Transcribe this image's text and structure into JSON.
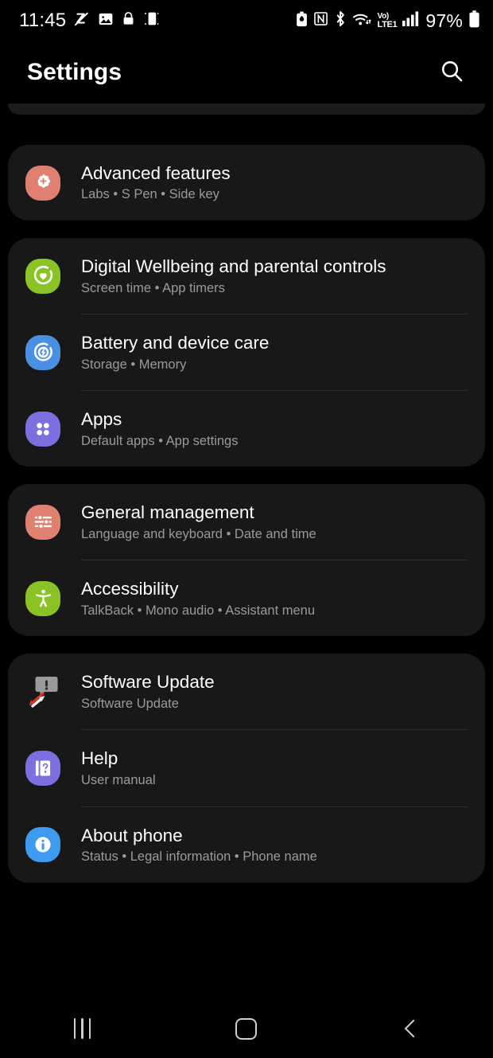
{
  "status_bar": {
    "time": "11:45",
    "battery_percent": "97%",
    "network_label": "LTE1",
    "volte_label": "Vo)",
    "left_icons": [
      "do-not-disturb-icon",
      "gallery-image-icon",
      "lock-icon",
      "screen-mirror-icon"
    ],
    "right_icons": [
      "battery-saver-icon",
      "nfc-icon",
      "bluetooth-icon",
      "wifi-icon",
      "volte-icon",
      "signal-bars-icon",
      "battery-icon"
    ]
  },
  "header": {
    "title": "Settings",
    "search_icon": "search-icon"
  },
  "sections": [
    {
      "id": "section-advanced",
      "items": [
        {
          "id": "advanced-features",
          "title": "Advanced features",
          "subtitle": "Labs  •  S Pen  •  Side key",
          "icon": "advanced-features-icon",
          "icon_bg": "#e08070"
        }
      ]
    },
    {
      "id": "section-wellbeing",
      "items": [
        {
          "id": "digital-wellbeing",
          "title": "Digital Wellbeing and parental controls",
          "subtitle": "Screen time  •  App timers",
          "icon": "digital-wellbeing-icon",
          "icon_bg": "#8bc225"
        },
        {
          "id": "battery-device-care",
          "title": "Battery and device care",
          "subtitle": "Storage  •  Memory",
          "icon": "battery-device-care-icon",
          "icon_bg": "#4a90e2"
        },
        {
          "id": "apps",
          "title": "Apps",
          "subtitle": "Default apps  •  App settings",
          "icon": "apps-icon",
          "icon_bg": "#7c6fe0"
        }
      ]
    },
    {
      "id": "section-general",
      "items": [
        {
          "id": "general-management",
          "title": "General management",
          "subtitle": "Language and keyboard  •  Date and time",
          "icon": "general-management-icon",
          "icon_bg": "#e08070"
        },
        {
          "id": "accessibility",
          "title": "Accessibility",
          "subtitle": "TalkBack  •  Mono audio  •  Assistant menu",
          "icon": "accessibility-icon",
          "icon_bg": "#8bc225"
        }
      ]
    },
    {
      "id": "section-about",
      "items": [
        {
          "id": "software-update",
          "title": "Software Update",
          "subtitle": "Software Update",
          "icon": "software-update-icon",
          "icon_bg": "transparent"
        },
        {
          "id": "help",
          "title": "Help",
          "subtitle": "User manual",
          "icon": "help-icon",
          "icon_bg": "#7c6fe0"
        },
        {
          "id": "about-phone",
          "title": "About phone",
          "subtitle": "Status  •  Legal information  •  Phone name",
          "icon": "about-phone-icon",
          "icon_bg": "#3f9bf0"
        }
      ]
    }
  ],
  "nav_bar": {
    "recents_label": "recents-icon",
    "home_label": "home-icon",
    "back_label": "back-icon"
  }
}
